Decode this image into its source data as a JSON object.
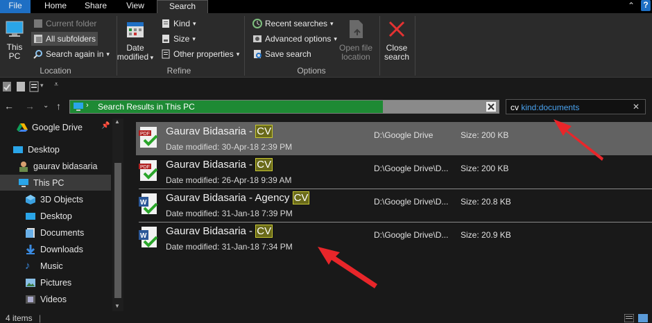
{
  "ribbon_tabs": {
    "file": "File",
    "home": "Home",
    "share": "Share",
    "view": "View",
    "search": "Search"
  },
  "ribbon": {
    "location": {
      "label": "Location",
      "this_pc_line1": "This",
      "this_pc_line2": "PC",
      "current_folder": "Current folder",
      "all_subfolders": "All subfolders",
      "search_again_in": "Search again in"
    },
    "refine": {
      "label": "Refine",
      "date_modified_line1": "Date",
      "date_modified_line2": "modified",
      "kind": "Kind",
      "size": "Size",
      "other_properties": "Other properties"
    },
    "options": {
      "label": "Options",
      "recent_searches": "Recent searches",
      "advanced_options": "Advanced options",
      "save_search": "Save search",
      "open_file_location_line1": "Open file",
      "open_file_location_line2": "location"
    },
    "close_search_line1": "Close",
    "close_search_line2": "search"
  },
  "address_bar": {
    "path": "Search Results in This PC",
    "progress_fraction": 0.73
  },
  "search_box": {
    "term": "cv",
    "filter": "kind:documents"
  },
  "nav_pane": {
    "items": [
      {
        "label": "Google Drive",
        "icon": "google-drive-icon"
      },
      {
        "label": "Desktop",
        "icon": "desktop-icon"
      },
      {
        "label": "gaurav bidasaria",
        "icon": "user-icon"
      },
      {
        "label": "This PC",
        "icon": "this-pc-icon"
      },
      {
        "label": "3D Objects",
        "icon": "3d-objects-icon"
      },
      {
        "label": "Desktop",
        "icon": "desktop-icon"
      },
      {
        "label": "Documents",
        "icon": "documents-icon"
      },
      {
        "label": "Downloads",
        "icon": "downloads-icon"
      },
      {
        "label": "Music",
        "icon": "music-icon"
      },
      {
        "label": "Pictures",
        "icon": "pictures-icon"
      },
      {
        "label": "Videos",
        "icon": "videos-icon"
      }
    ]
  },
  "results": [
    {
      "name": "Gaurav Bidasaria - ",
      "highlight": "CV",
      "date_label": "Date modified:",
      "date": "30-Apr-18 2:39 PM",
      "path": "D:\\Google Drive",
      "size_label": "Size:",
      "size": "200 KB",
      "type": "pdf"
    },
    {
      "name": "Gaurav Bidasaria - ",
      "highlight": "CV",
      "date_label": "Date modified:",
      "date": "26-Apr-18 9:39 AM",
      "path": "D:\\Google Drive\\D...",
      "size_label": "Size:",
      "size": "200 KB",
      "type": "pdf"
    },
    {
      "name": "Gaurav Bidasaria - Agency ",
      "highlight": "CV",
      "date_label": "Date modified:",
      "date": "31-Jan-18 7:39 PM",
      "path": "D:\\Google Drive\\D...",
      "size_label": "Size:",
      "size": "20.8 KB",
      "type": "word"
    },
    {
      "name": "Gaurav Bidasaria - ",
      "highlight": "CV",
      "date_label": "Date modified:",
      "date": "31-Jan-18 7:34 PM",
      "path": "D:\\Google Drive\\D...",
      "size_label": "Size:",
      "size": "20.9 KB",
      "type": "word"
    }
  ],
  "status_bar": {
    "item_count": "4 items"
  },
  "colors": {
    "accent_blue": "#1e6fc4",
    "address_progress": "#1e8a34",
    "highlight_box": "#c8c832",
    "annotation_arrow": "#e8262a"
  }
}
